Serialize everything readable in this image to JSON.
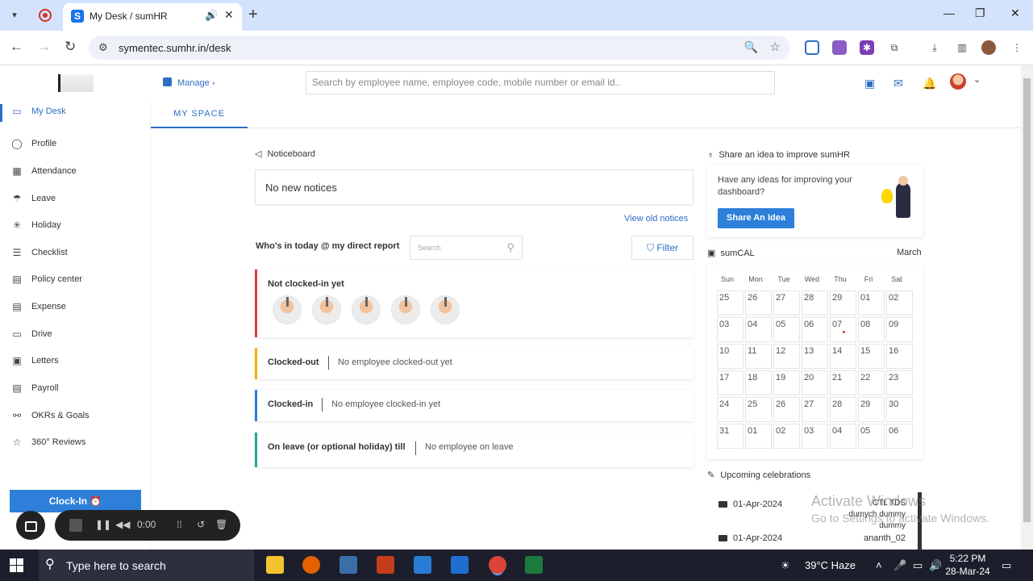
{
  "browser": {
    "tab_title": "My Desk / sumHR",
    "tab_favicon": "S",
    "url": "symentec.sumhr.in/desk"
  },
  "header": {
    "manage_label": "Manage",
    "search_placeholder": "Search by employee name, employee code, mobile number or email id.."
  },
  "sidebar": {
    "items": [
      {
        "label": "My Desk",
        "icon": "monitor-icon"
      },
      {
        "label": "Profile",
        "icon": "user-icon"
      },
      {
        "label": "Attendance",
        "icon": "calendar-icon"
      },
      {
        "label": "Leave",
        "icon": "leave-icon"
      },
      {
        "label": "Holiday",
        "icon": "holiday-icon"
      },
      {
        "label": "Checklist",
        "icon": "checklist-icon"
      },
      {
        "label": "Policy center",
        "icon": "policy-icon"
      },
      {
        "label": "Expense",
        "icon": "expense-icon"
      },
      {
        "label": "Drive",
        "icon": "folder-icon"
      },
      {
        "label": "Letters",
        "icon": "letters-icon"
      },
      {
        "label": "Payroll",
        "icon": "payroll-icon"
      },
      {
        "label": "OKRs & Goals",
        "icon": "goals-icon"
      },
      {
        "label": "360° Reviews",
        "icon": "star-icon"
      }
    ],
    "clockin_label": "Clock-In ⏰"
  },
  "recorder": {
    "time": "0:00"
  },
  "main": {
    "tab_label": "MY SPACE",
    "noticeboard_title": "Noticeboard",
    "no_notices": "No new notices",
    "view_old": "View old notices",
    "whos_in_title": "Who's in today @ my direct report",
    "search_placeholder": "Search",
    "filter_label": "Filter",
    "not_clocked_title": "Not clocked-in yet",
    "clocked_out_label": "Clocked-out",
    "clocked_out_msg": "No employee clocked-out yet",
    "clocked_in_label": "Clocked-in",
    "clocked_in_msg": "No employee clocked-in yet",
    "on_leave_label": "On leave (or optional holiday) till",
    "on_leave_msg": "No employee on leave"
  },
  "idea": {
    "title": "Share an idea to improve sumHR",
    "text": "Have any ideas for improving your dashboard?",
    "button": "Share An Idea"
  },
  "calendar": {
    "title": "sumCAL",
    "month": "March",
    "weekdays": [
      "Sun",
      "Mon",
      "Tue",
      "Wed",
      "Thu",
      "Fri",
      "Sat"
    ],
    "weeks": [
      [
        "25",
        "26",
        "27",
        "28",
        "29",
        "01",
        "02"
      ],
      [
        "03",
        "04",
        "05",
        "06",
        "07",
        "08",
        "09"
      ],
      [
        "10",
        "11",
        "12",
        "13",
        "14",
        "15",
        "16"
      ],
      [
        "17",
        "18",
        "19",
        "20",
        "21",
        "22",
        "23"
      ],
      [
        "24",
        "25",
        "26",
        "27",
        "28",
        "29",
        "30"
      ],
      [
        "31",
        "01",
        "02",
        "03",
        "04",
        "05",
        "06"
      ]
    ]
  },
  "celebrations": {
    "title": "Upcoming celebrations",
    "items": [
      {
        "date": "01-Apr-2024",
        "name": "CTL TDS dumych dummy dummy"
      },
      {
        "date": "01-Apr-2024",
        "name": "ananth_02"
      }
    ]
  },
  "watermark": {
    "line1": "Activate Windows",
    "line2": "Go to Settings to activate Windows."
  },
  "taskbar": {
    "search_text": "Type here to search",
    "weather": "39°C  Haze",
    "time": "5:22 PM",
    "date": "28-Mar-24"
  }
}
